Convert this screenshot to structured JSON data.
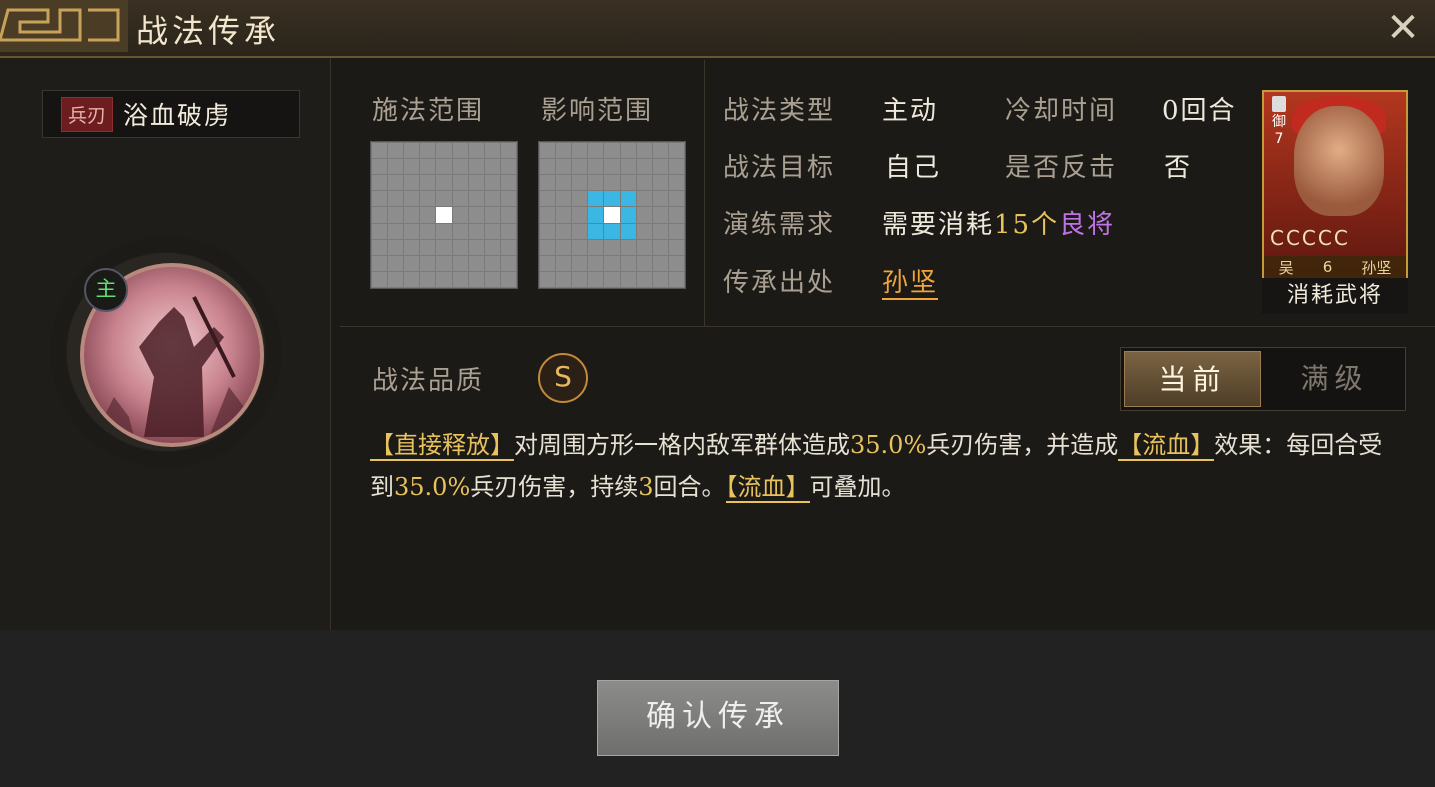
{
  "window": {
    "title": "战法传承",
    "close_icon": "close-icon"
  },
  "skill": {
    "type_badge": "兵刃",
    "name": "浴血破虏",
    "main_badge": "主"
  },
  "ranges": {
    "cast_label": "施法范围",
    "effect_label": "影响范围"
  },
  "info": {
    "type_label": "战法类型",
    "type_value": "主动",
    "cooldown_label": "冷却时间",
    "cooldown_value": "0回合",
    "target_label": "战法目标",
    "target_value": "自己",
    "counter_label": "是否反击",
    "counter_value": "否",
    "practice_label": "演练需求",
    "practice_prefix": "需要消耗",
    "practice_count": "15个",
    "practice_unit": "良将",
    "source_label": "传承出处",
    "source_value": "孙坚"
  },
  "hero_card": {
    "side_text": "御",
    "side_num": "7",
    "stars": "CCCCC",
    "faction": "吴",
    "cost": "6",
    "name": "孙坚",
    "consume_label": "消耗武将"
  },
  "quality": {
    "label": "战法品质",
    "grade": "S"
  },
  "toggle": {
    "current": "当前",
    "max": "满级"
  },
  "description": {
    "kw1": "【直接释放】",
    "t1": "对周围方形一格内敌军群体造成",
    "n1": "35.0%",
    "t2": "兵刃伤害，并造成",
    "kw2": "【流血】",
    "t3": "效果：每回合受到",
    "n2": "35.0%",
    "t4": "兵刃伤害，持续",
    "n3": "3",
    "t5": "回合。",
    "kw3": "【流血】",
    "t6": "可叠加。"
  },
  "confirm_button": "确认传承",
  "colors": {
    "accent_gold": "#e8c25c",
    "link_orange": "#f0a43a",
    "aoe_blue": "#3cb6e3",
    "purple": "#c073e6"
  }
}
